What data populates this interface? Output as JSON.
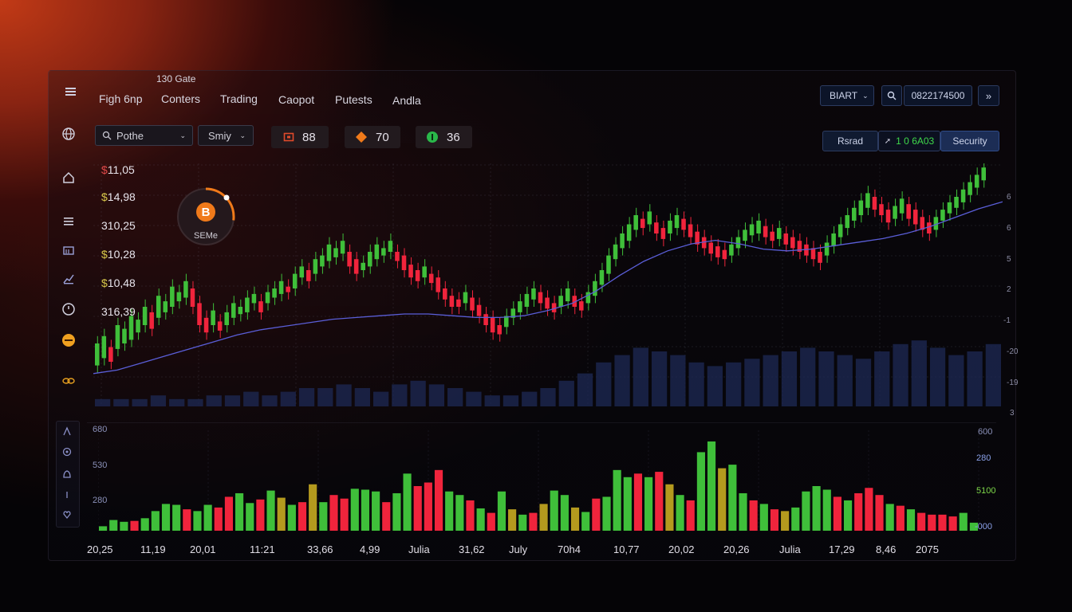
{
  "nav": {
    "menu_icon": "hamburger-icon",
    "top_label": "130 Gate",
    "items": [
      "Figh 6np",
      "Conters",
      "Trading",
      "Caopot",
      "Putests",
      "Andla"
    ]
  },
  "topright": {
    "select_label": "BIART",
    "search_icon": "search-icon",
    "number": "0822174500",
    "forward_icon": "double-chevron-right-icon"
  },
  "toolbar": {
    "search_placeholder": "Pothe",
    "dropdown2": "Smiy",
    "chips": [
      {
        "icon": "wallet-icon",
        "value": "88",
        "color": "#e04a2a"
      },
      {
        "icon": "diamond-icon",
        "value": "70",
        "color": "#f07a1a"
      },
      {
        "icon": "coin-icon",
        "value": "36",
        "color": "#2ab84a"
      }
    ]
  },
  "right_tabs": {
    "tab1": "Rsrad",
    "tab2": "1 0 6A03",
    "tab3": "Security"
  },
  "sidebar": {
    "icons": [
      "globe-icon",
      "home-icon",
      "list-icon",
      "folder-icon",
      "chart-icon",
      "clock-icon",
      "coin-icon",
      "link-icon"
    ],
    "sub_icons": [
      "user-icon",
      "gear-icon",
      "bell-icon",
      "info-icon",
      "heart-icon"
    ]
  },
  "prices": [
    {
      "sym": "$",
      "val": "11,05",
      "color": "#e24a4a"
    },
    {
      "sym": "$",
      "val": "14,98",
      "color": "#d9c84a"
    },
    {
      "sym": "",
      "val": "310,25",
      "color": "#e8e4ec"
    },
    {
      "sym": "$",
      "val": "10,28",
      "color": "#d9c84a"
    },
    {
      "sym": "$",
      "val": "10,48",
      "color": "#d9c84a"
    },
    {
      "sym": "",
      "val": "316,39",
      "color": "#e8e4ec"
    }
  ],
  "coin_widget": {
    "icon": "bitcoin-icon",
    "label": "SEMe",
    "progress": 0.27,
    "accent": "#f07a1a"
  },
  "right_axis": [
    "6",
    "6",
    "5",
    "2",
    "-1",
    "-20",
    "-19",
    "3"
  ],
  "volume_axis_left": [
    "680",
    "530",
    "280"
  ],
  "volume_axis_right": [
    "600",
    "280",
    "5100",
    "-000"
  ],
  "x_labels": [
    "20,25",
    "11,19",
    "20,01",
    "11:21",
    "33,66",
    "4,99",
    "Julia",
    "31,62",
    "July",
    "70h4",
    "10,77",
    "20,02",
    "20,26",
    "Julia",
    "17,29",
    "8,46",
    "2075"
  ],
  "colors": {
    "up": "#3fbf3a",
    "down": "#f0243c",
    "ma": "#5a5ed8",
    "volume_bg": "#1e2a55",
    "neutral": "#b49a1e"
  },
  "chart_data": {
    "type": "candlestick",
    "price_candles": [
      [
        0.3,
        0.18
      ],
      [
        0.34,
        0.22
      ],
      [
        0.28,
        0.2
      ],
      [
        0.4,
        0.27
      ],
      [
        0.38,
        0.3
      ],
      [
        0.45,
        0.32
      ],
      [
        0.43,
        0.36
      ],
      [
        0.5,
        0.4
      ],
      [
        0.47,
        0.38
      ],
      [
        0.56,
        0.44
      ],
      [
        0.53,
        0.47
      ],
      [
        0.61,
        0.5
      ],
      [
        0.58,
        0.53
      ],
      [
        0.64,
        0.55
      ],
      [
        0.6,
        0.5
      ],
      [
        0.52,
        0.4
      ],
      [
        0.44,
        0.36
      ],
      [
        0.48,
        0.4
      ],
      [
        0.42,
        0.37
      ],
      [
        0.47,
        0.4
      ],
      [
        0.52,
        0.44
      ],
      [
        0.5,
        0.46
      ],
      [
        0.55,
        0.47
      ],
      [
        0.57,
        0.52
      ],
      [
        0.53,
        0.47
      ],
      [
        0.58,
        0.52
      ],
      [
        0.6,
        0.55
      ],
      [
        0.64,
        0.57
      ],
      [
        0.61,
        0.58
      ],
      [
        0.68,
        0.6
      ],
      [
        0.72,
        0.66
      ],
      [
        0.7,
        0.64
      ],
      [
        0.76,
        0.68
      ],
      [
        0.78,
        0.72
      ],
      [
        0.84,
        0.75
      ],
      [
        0.82,
        0.77
      ],
      [
        0.86,
        0.79
      ],
      [
        0.8,
        0.72
      ],
      [
        0.76,
        0.68
      ],
      [
        0.74,
        0.7
      ],
      [
        0.8,
        0.72
      ],
      [
        0.84,
        0.76
      ],
      [
        0.82,
        0.78
      ],
      [
        0.86,
        0.8
      ],
      [
        0.8,
        0.75
      ],
      [
        0.78,
        0.7
      ],
      [
        0.73,
        0.66
      ],
      [
        0.7,
        0.64
      ],
      [
        0.72,
        0.66
      ],
      [
        0.68,
        0.63
      ],
      [
        0.66,
        0.58
      ],
      [
        0.6,
        0.54
      ],
      [
        0.56,
        0.5
      ],
      [
        0.54,
        0.5
      ],
      [
        0.58,
        0.52
      ],
      [
        0.55,
        0.48
      ],
      [
        0.51,
        0.45
      ],
      [
        0.46,
        0.4
      ],
      [
        0.44,
        0.36
      ],
      [
        0.4,
        0.35
      ],
      [
        0.45,
        0.39
      ],
      [
        0.49,
        0.44
      ],
      [
        0.53,
        0.47
      ],
      [
        0.57,
        0.5
      ],
      [
        0.6,
        0.54
      ],
      [
        0.58,
        0.52
      ],
      [
        0.55,
        0.49
      ],
      [
        0.52,
        0.47
      ],
      [
        0.56,
        0.5
      ],
      [
        0.6,
        0.53
      ],
      [
        0.56,
        0.5
      ],
      [
        0.53,
        0.48
      ],
      [
        0.58,
        0.52
      ],
      [
        0.64,
        0.56
      ],
      [
        0.7,
        0.62
      ],
      [
        0.78,
        0.68
      ],
      [
        0.84,
        0.76
      ],
      [
        0.9,
        0.82
      ],
      [
        0.95,
        0.86
      ],
      [
        1.0,
        0.92
      ],
      [
        0.98,
        0.93
      ],
      [
        1.02,
        0.95
      ],
      [
        0.96,
        0.9
      ],
      [
        0.93,
        0.87
      ],
      [
        0.97,
        0.9
      ],
      [
        1.0,
        0.93
      ],
      [
        0.98,
        0.92
      ],
      [
        0.95,
        0.88
      ],
      [
        0.91,
        0.84
      ],
      [
        0.88,
        0.82
      ],
      [
        0.85,
        0.79
      ],
      [
        0.83,
        0.77
      ],
      [
        0.81,
        0.76
      ],
      [
        0.84,
        0.78
      ],
      [
        0.88,
        0.82
      ],
      [
        0.92,
        0.86
      ],
      [
        0.95,
        0.89
      ],
      [
        0.97,
        0.9
      ],
      [
        0.94,
        0.88
      ],
      [
        0.91,
        0.86
      ],
      [
        0.93,
        0.87
      ],
      [
        0.9,
        0.84
      ],
      [
        0.88,
        0.82
      ],
      [
        0.86,
        0.8
      ],
      [
        0.84,
        0.78
      ],
      [
        0.82,
        0.76
      ],
      [
        0.8,
        0.74
      ],
      [
        0.85,
        0.78
      ],
      [
        0.9,
        0.83
      ],
      [
        0.95,
        0.88
      ],
      [
        1.0,
        0.93
      ],
      [
        1.04,
        0.97
      ],
      [
        1.08,
        1.0
      ],
      [
        1.12,
        1.04
      ],
      [
        1.1,
        1.03
      ],
      [
        1.06,
        1.0
      ],
      [
        1.03,
        0.96
      ],
      [
        1.05,
        0.98
      ],
      [
        1.09,
        1.01
      ],
      [
        1.06,
        0.98
      ],
      [
        1.03,
        0.95
      ],
      [
        0.99,
        0.92
      ],
      [
        0.96,
        0.9
      ],
      [
        0.99,
        0.92
      ],
      [
        1.03,
        0.97
      ],
      [
        1.07,
        1.01
      ],
      [
        1.1,
        1.04
      ],
      [
        1.14,
        1.07
      ],
      [
        1.18,
        1.11
      ],
      [
        1.22,
        1.15
      ],
      [
        1.26,
        1.19
      ]
    ],
    "moving_average": [
      0.16,
      0.18,
      0.22,
      0.26,
      0.3,
      0.34,
      0.38,
      0.41,
      0.43,
      0.45,
      0.47,
      0.48,
      0.49,
      0.5,
      0.5,
      0.49,
      0.48,
      0.48,
      0.49,
      0.52,
      0.56,
      0.63,
      0.72,
      0.8,
      0.86,
      0.9,
      0.92,
      0.9,
      0.87,
      0.86,
      0.87,
      0.89,
      0.91,
      0.93,
      0.96,
      1.0,
      1.05,
      1.1,
      1.14
    ],
    "volume_bg": [
      2,
      2,
      2,
      3,
      2,
      2,
      3,
      3,
      4,
      3,
      4,
      5,
      5,
      6,
      5,
      4,
      6,
      7,
      6,
      5,
      4,
      3,
      3,
      4,
      5,
      7,
      9,
      12,
      14,
      16,
      15,
      14,
      12,
      11,
      12,
      13,
      14,
      15,
      16,
      15,
      14,
      13,
      15,
      17,
      18,
      16,
      14,
      15,
      17
    ],
    "lower_volume": [
      [
        0.05,
        "up"
      ],
      [
        0.12,
        "up"
      ],
      [
        0.1,
        "up"
      ],
      [
        0.11,
        "down"
      ],
      [
        0.14,
        "up"
      ],
      [
        0.22,
        "up"
      ],
      [
        0.3,
        "up"
      ],
      [
        0.29,
        "up"
      ],
      [
        0.24,
        "down"
      ],
      [
        0.22,
        "up"
      ],
      [
        0.29,
        "up"
      ],
      [
        0.26,
        "down"
      ],
      [
        0.38,
        "down"
      ],
      [
        0.42,
        "up"
      ],
      [
        0.31,
        "up"
      ],
      [
        0.35,
        "down"
      ],
      [
        0.45,
        "up"
      ],
      [
        0.37,
        "neutral"
      ],
      [
        0.29,
        "up"
      ],
      [
        0.32,
        "down"
      ],
      [
        0.52,
        "neutral"
      ],
      [
        0.32,
        "up"
      ],
      [
        0.4,
        "down"
      ],
      [
        0.36,
        "down"
      ],
      [
        0.47,
        "up"
      ],
      [
        0.46,
        "up"
      ],
      [
        0.44,
        "up"
      ],
      [
        0.32,
        "down"
      ],
      [
        0.42,
        "up"
      ],
      [
        0.64,
        "up"
      ],
      [
        0.5,
        "down"
      ],
      [
        0.54,
        "down"
      ],
      [
        0.68,
        "down"
      ],
      [
        0.44,
        "up"
      ],
      [
        0.4,
        "up"
      ],
      [
        0.34,
        "down"
      ],
      [
        0.25,
        "up"
      ],
      [
        0.2,
        "down"
      ],
      [
        0.44,
        "up"
      ],
      [
        0.24,
        "neutral"
      ],
      [
        0.18,
        "up"
      ],
      [
        0.2,
        "down"
      ],
      [
        0.3,
        "neutral"
      ],
      [
        0.45,
        "up"
      ],
      [
        0.4,
        "up"
      ],
      [
        0.26,
        "neutral"
      ],
      [
        0.21,
        "up"
      ],
      [
        0.36,
        "down"
      ],
      [
        0.38,
        "up"
      ],
      [
        0.68,
        "up"
      ],
      [
        0.6,
        "up"
      ],
      [
        0.64,
        "down"
      ],
      [
        0.6,
        "up"
      ],
      [
        0.66,
        "down"
      ],
      [
        0.52,
        "neutral"
      ],
      [
        0.4,
        "up"
      ],
      [
        0.34,
        "down"
      ],
      [
        0.88,
        "up"
      ],
      [
        1.0,
        "up"
      ],
      [
        0.7,
        "neutral"
      ],
      [
        0.74,
        "up"
      ],
      [
        0.42,
        "up"
      ],
      [
        0.34,
        "down"
      ],
      [
        0.3,
        "up"
      ],
      [
        0.24,
        "down"
      ],
      [
        0.22,
        "neutral"
      ],
      [
        0.26,
        "up"
      ],
      [
        0.44,
        "up"
      ],
      [
        0.5,
        "up"
      ],
      [
        0.46,
        "up"
      ],
      [
        0.38,
        "down"
      ],
      [
        0.34,
        "up"
      ],
      [
        0.42,
        "down"
      ],
      [
        0.48,
        "down"
      ],
      [
        0.4,
        "down"
      ],
      [
        0.3,
        "up"
      ],
      [
        0.28,
        "down"
      ],
      [
        0.24,
        "up"
      ],
      [
        0.2,
        "down"
      ],
      [
        0.18,
        "down"
      ],
      [
        0.18,
        "down"
      ],
      [
        0.16,
        "down"
      ],
      [
        0.2,
        "up"
      ],
      [
        0.09,
        "up"
      ]
    ]
  }
}
